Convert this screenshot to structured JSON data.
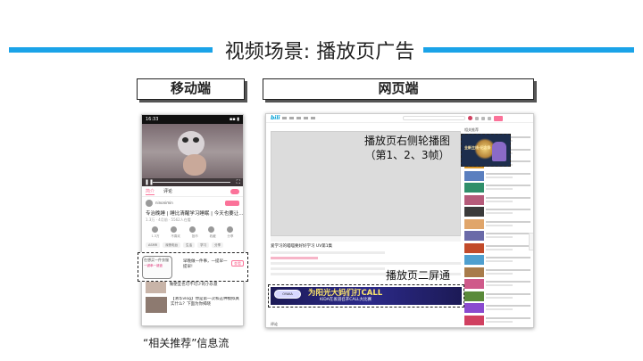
{
  "slide": {
    "title": "视频场景: 播放页广告",
    "accent_color": "#1aa3e8"
  },
  "labels": {
    "mobile": "移动端",
    "web": "网页端"
  },
  "mobile": {
    "status_time": "16:33",
    "status_right": "▪▪ ▮",
    "tabs": {
      "active": "简介",
      "second": "评论"
    },
    "uploader_name": "ninonimin",
    "video_title": "专治晚睡 | 睡比清醒学习睡眠 | 今天也要让...",
    "video_meta": "1.3万  · 4月前 · 5562人在看",
    "action_labels": [
      "1.3万",
      "不喜欢",
      "投币",
      "收藏",
      "分享"
    ],
    "chips": [
      "ASMR",
      "深夜电台",
      "生活",
      "学习",
      "分享"
    ],
    "ad": {
      "comic_text": "在想买一件衣服",
      "comic_sub": "一键拳一键盘",
      "bubble": "早晚做一件事，一提早一提早!",
      "button": "查看"
    },
    "recommendations": [
      {
        "title": "【好吃星期LOLO】如何调教一只LOLO做便宜也可不可少的小乐意"
      },
      {
        "title": "【清华vlog】你是第一次和这种模拟真实什么？下面为你揭晓"
      }
    ],
    "caption": "“相关推荐”信息流"
  },
  "web": {
    "logo": "bili",
    "video_title": "爱学习的喵喵要好好学习 UV第1集",
    "right_heading": "相关推荐",
    "comments_heading": "评论",
    "side_ad_text": "全新主线·纪念祭",
    "banner": {
      "logo": "OYAKA",
      "title": "为阳光大妈们打CALL",
      "sub": "KIDA在坂道召开CALL大比赛"
    },
    "thumb_colors": [
      "#c83a3a",
      "#7b5bb0",
      "#d9982a",
      "#5a7fbf",
      "#2f8f6a",
      "#b55b7a",
      "#3b3b3b",
      "#e0a56a",
      "#6a6aa8",
      "#c24a2a",
      "#4f9fcf",
      "#a87b4a",
      "#cf5a8a",
      "#5a8a3a",
      "#8a4acf",
      "#d04060",
      "#3a6a9a",
      "#bf8a2a"
    ]
  },
  "callouts": {
    "side": "播放页右侧轮播图\n（第1、2、3帧）",
    "banner": "播放页二屏通"
  }
}
